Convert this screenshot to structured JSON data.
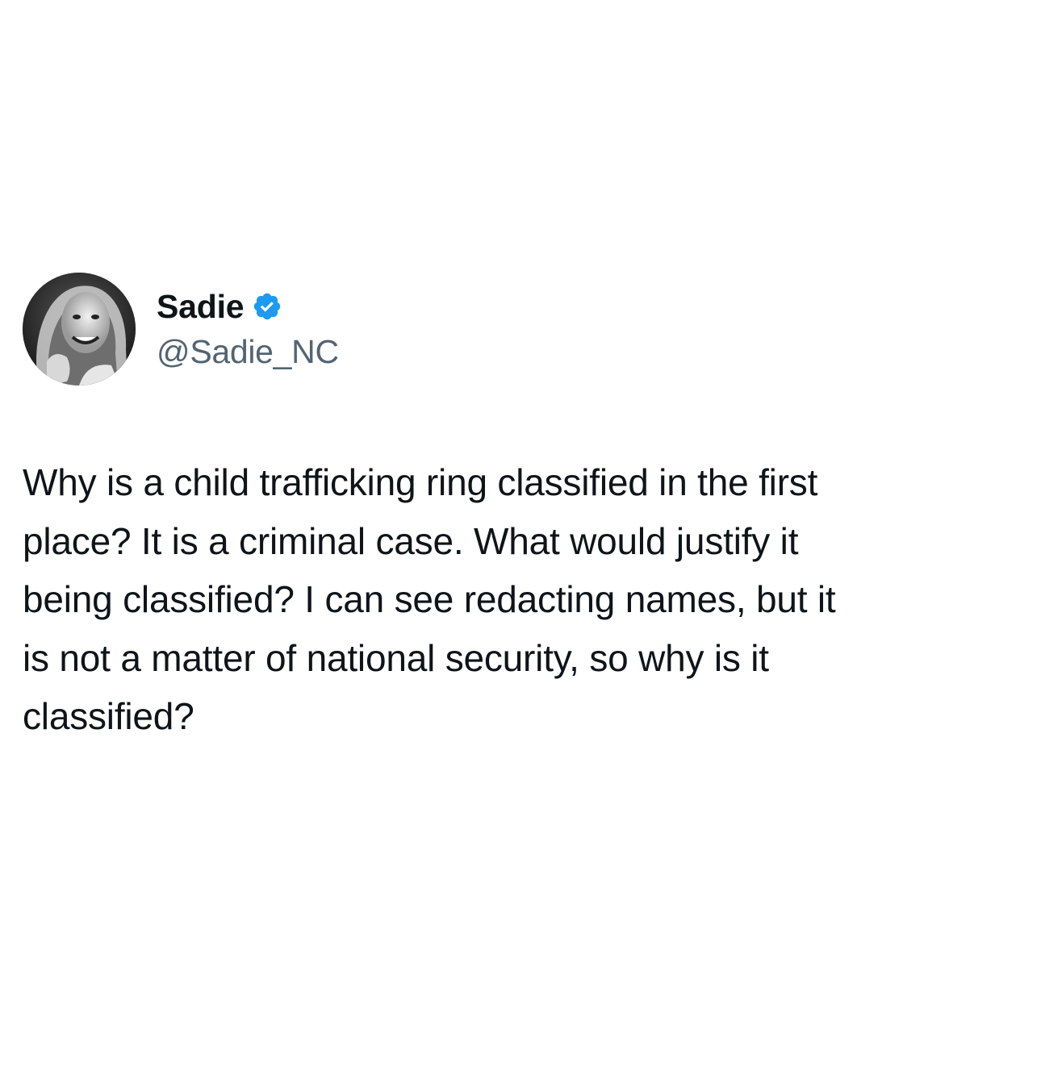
{
  "tweet": {
    "author": {
      "display_name": "Sadie",
      "handle": "@Sadie_NC",
      "verified_icon": "verified-badge-icon",
      "verified_color": "#1d9bf0"
    },
    "text": "Why is a child trafficking ring classified in the first\nplace? It is a criminal case. What would justify it\nbeing classified? I can see redacting names, but it\nis not a matter of national security, so why is it\nclassified?"
  }
}
